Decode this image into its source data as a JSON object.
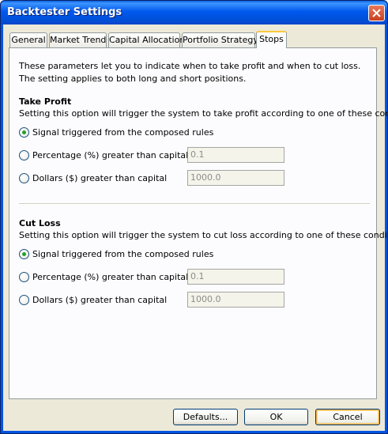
{
  "window": {
    "title": "Backtester Settings",
    "close_label": "close"
  },
  "tabs": [
    {
      "label": "General",
      "active": false
    },
    {
      "label": "Market Trend",
      "active": false
    },
    {
      "label": "Capital Allocation",
      "active": false
    },
    {
      "label": "Portfolio Strategy",
      "active": false
    },
    {
      "label": "Stops",
      "active": true
    }
  ],
  "intro": {
    "line1": "These parameters let you to indicate when to take profit and when to cut loss.",
    "line2": "The setting applies to both long and short positions."
  },
  "take_profit": {
    "title": "Take Profit",
    "description": "Setting this option will trigger the system to take profit according to one of these conditions:",
    "options": [
      {
        "label": "Signal triggered from the composed rules",
        "selected": true
      },
      {
        "label": "Percentage (%) greater than capital",
        "selected": false,
        "value": "0.1"
      },
      {
        "label": "Dollars ($) greater than capital",
        "selected": false,
        "value": "1000.0"
      }
    ]
  },
  "cut_loss": {
    "title": "Cut Loss",
    "description": "Setting this option will trigger the system to cut loss according to one of these conditions:",
    "options": [
      {
        "label": "Signal triggered from the composed rules",
        "selected": true
      },
      {
        "label": "Percentage (%) greater than capital",
        "selected": false,
        "value": "0.1"
      },
      {
        "label": "Dollars ($) greater than capital",
        "selected": false,
        "value": "1000.0"
      }
    ]
  },
  "buttons": {
    "defaults": "Defaults...",
    "ok": "OK",
    "cancel": "Cancel"
  },
  "colors": {
    "titlebar": "#0058ee",
    "client_bg": "#ece9d8",
    "radio_dot": "#21a121",
    "active_tab_accent": "#ffc83c"
  }
}
